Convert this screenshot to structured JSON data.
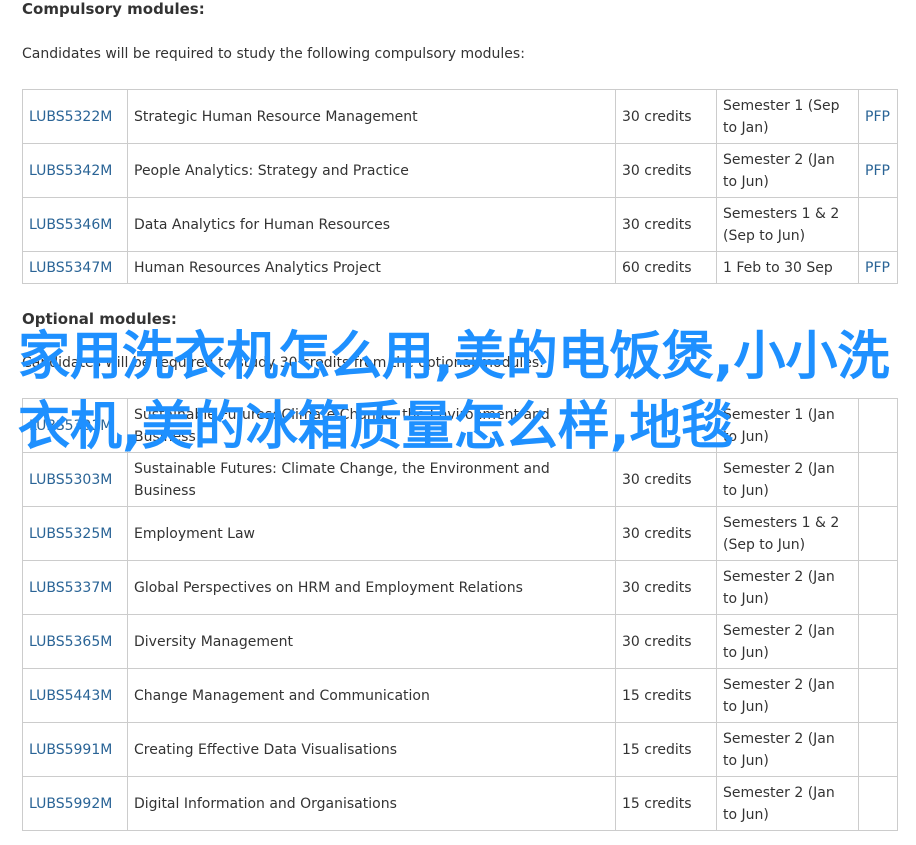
{
  "compulsory": {
    "heading": "Compulsory modules:",
    "intro": "Candidates will be required to study the following compulsory modules:",
    "rows": [
      {
        "code": "LUBS5322M",
        "title": "Strategic Human Resource Management",
        "credits": "30 credits",
        "period": "Semester 1 (Sep to Jan)",
        "spec": "PFP"
      },
      {
        "code": "LUBS5342M",
        "title": "People Analytics: Strategy and Practice",
        "credits": "30 credits",
        "period": "Semester 2 (Jan to Jun)",
        "spec": "PFP"
      },
      {
        "code": "LUBS5346M",
        "title": "Data Analytics for Human Resources",
        "credits": "30 credits",
        "period": "Semesters 1 & 2 (Sep to Jun)",
        "spec": ""
      },
      {
        "code": "LUBS5347M",
        "title": "Human Resources Analytics Project",
        "credits": "60 credits",
        "period": "1 Feb to 30 Sep",
        "spec": "PFP"
      }
    ]
  },
  "optional": {
    "heading": "Optional modules:",
    "intro": "Candidates will be required to study 30 credits from the optional modules:",
    "rows": [
      {
        "code": "LUBS5301M",
        "title": "Sustainable Futures: Climate Change, the Environment and Business",
        "credits": "",
        "period": "Semester 1 (Jan to Jun)",
        "spec": ""
      },
      {
        "code": "LUBS5303M",
        "title": "Sustainable Futures: Climate Change, the Environment and Business",
        "credits": "30 credits",
        "period": "Semester 2 (Jan to Jun)",
        "spec": ""
      },
      {
        "code": "LUBS5325M",
        "title": "Employment Law",
        "credits": "30 credits",
        "period": "Semesters 1 & 2 (Sep to Jun)",
        "spec": ""
      },
      {
        "code": "LUBS5337M",
        "title": "Global Perspectives on HRM and Employment Relations",
        "credits": "30 credits",
        "period": "Semester 2 (Jan to Jun)",
        "spec": ""
      },
      {
        "code": "LUBS5365M",
        "title": "Diversity Management",
        "credits": "30 credits",
        "period": "Semester 2 (Jan to Jun)",
        "spec": ""
      },
      {
        "code": "LUBS5443M",
        "title": "Change Management and Communication",
        "credits": "15 credits",
        "period": "Semester 2 (Jan to Jun)",
        "spec": ""
      },
      {
        "code": "LUBS5991M",
        "title": "Creating Effective Data Visualisations",
        "credits": "15 credits",
        "period": "Semester 2 (Jan to Jun)",
        "spec": ""
      },
      {
        "code": "LUBS5992M",
        "title": "Digital Information and Organisations",
        "credits": "15 credits",
        "period": "Semester 2 (Jan to Jun)",
        "spec": ""
      }
    ]
  },
  "overlay_text": "家用洗衣机怎么用,美的电饭煲,小小洗衣机,美的冰箱质量怎么样,地毯",
  "colors": {
    "link": "#2a6496",
    "overlay": "#1e90ff",
    "border": "#cccccc"
  }
}
